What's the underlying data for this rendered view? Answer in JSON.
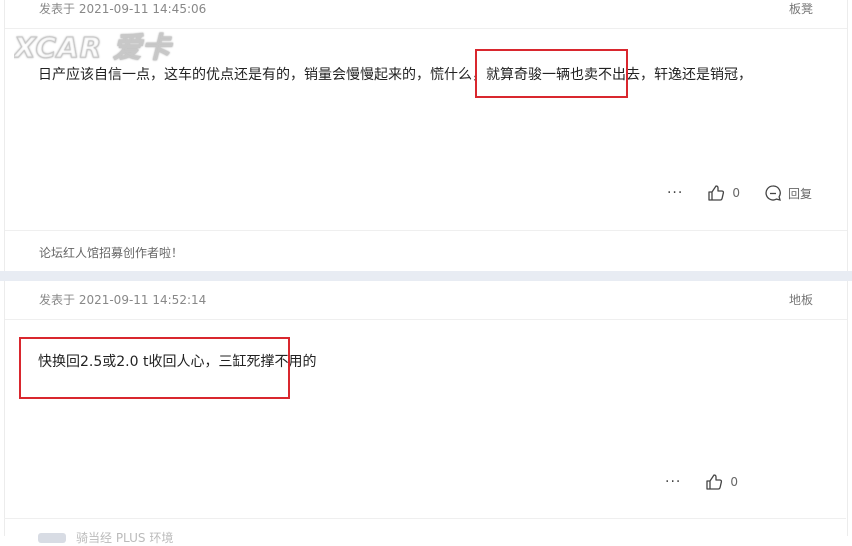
{
  "watermark": {
    "text": "XCAR 爱卡"
  },
  "posts": [
    {
      "time": "发表于 2021-09-11 14:45:06",
      "floor": "板凳",
      "content": "日产应该自信一点，这车的优点还是有的，销量会慢慢起来的，慌什么，就算奇骏一辆也卖不出去，轩逸还是销冠，",
      "more": "···",
      "likes": "0",
      "reply": "回复",
      "footer": "论坛红人馆招募创作者啦！"
    },
    {
      "time": "发表于 2021-09-11 14:52:14",
      "floor": "地板",
      "content": "快换回2.5或2.0 t收回人心，三缸死撑不用的",
      "more": "···",
      "likes": "0"
    }
  ],
  "next": {
    "text": "骑当经 PLUS 环境"
  }
}
